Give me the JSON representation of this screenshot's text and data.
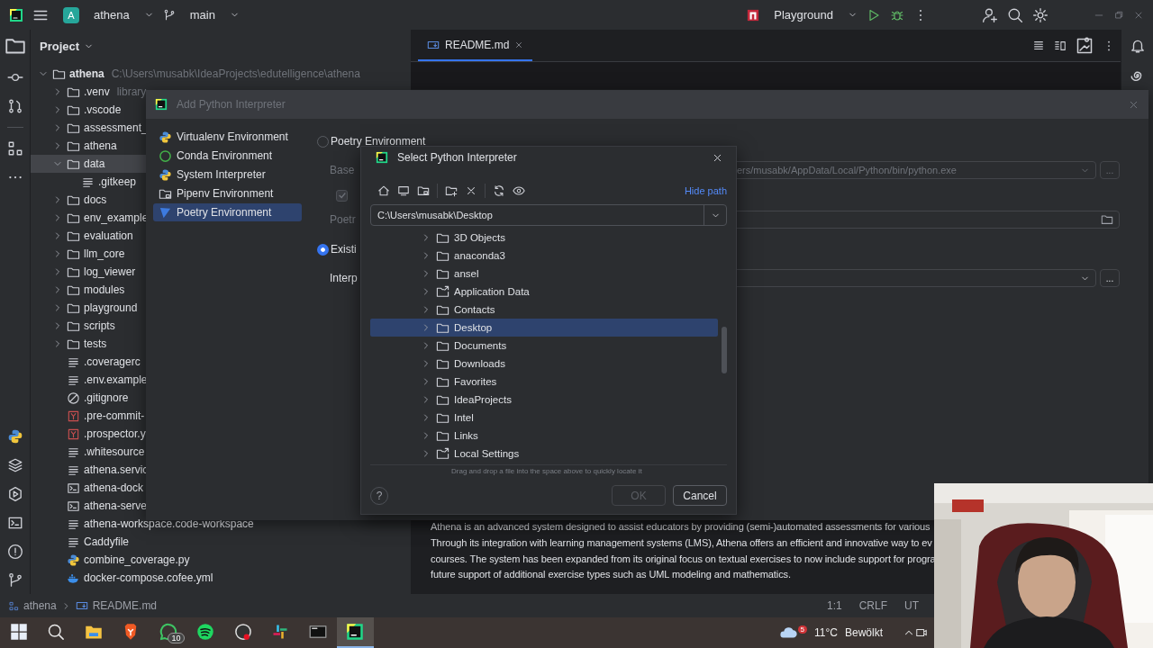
{
  "title_bar": {
    "project_badge": "A",
    "project": "athena",
    "branch": "main",
    "run_config": "Playground"
  },
  "project_panel": {
    "title": "Project",
    "tree": [
      {
        "name": "athena",
        "path": "C:\\Users\\musabk\\IdeaProjects\\edutelligence\\athena",
        "kind": "folder",
        "expanded": true,
        "selected": false,
        "children": [
          {
            "name": ".venv",
            "hint": "library",
            "kind": "folder",
            "expanded": false,
            "selected": false
          },
          {
            "name": ".vscode",
            "kind": "folder",
            "expanded": false,
            "selected": false
          },
          {
            "name": "assessment_",
            "kind": "folder",
            "expanded": false,
            "selected": false
          },
          {
            "name": "athena",
            "kind": "folder",
            "expanded": false,
            "selected": false
          },
          {
            "name": "data",
            "kind": "folder",
            "expanded": true,
            "selected": true,
            "children": [
              {
                "name": ".gitkeep",
                "kind": "text",
                "selected": false
              }
            ]
          },
          {
            "name": "docs",
            "kind": "folder",
            "expanded": false,
            "selected": false
          },
          {
            "name": "env_example",
            "kind": "folder",
            "expanded": false,
            "selected": false
          },
          {
            "name": "evaluation",
            "kind": "folder",
            "expanded": false,
            "selected": false
          },
          {
            "name": "llm_core",
            "kind": "folder",
            "expanded": false,
            "selected": false
          },
          {
            "name": "log_viewer",
            "kind": "folder",
            "expanded": false,
            "selected": false
          },
          {
            "name": "modules",
            "kind": "folder",
            "expanded": false,
            "selected": false
          },
          {
            "name": "playground",
            "kind": "folder",
            "expanded": false,
            "selected": false
          },
          {
            "name": "scripts",
            "kind": "folder",
            "expanded": false,
            "selected": false
          },
          {
            "name": "tests",
            "kind": "folder",
            "expanded": false,
            "selected": false
          },
          {
            "name": ".coveragerc",
            "kind": "text",
            "selected": false
          },
          {
            "name": ".env.example",
            "kind": "text",
            "selected": false
          },
          {
            "name": ".gitignore",
            "kind": "ignore",
            "selected": false
          },
          {
            "name": ".pre-commit-",
            "kind": "yaml",
            "selected": false
          },
          {
            "name": ".prospector.y",
            "kind": "yaml",
            "selected": false
          },
          {
            "name": ".whitesource",
            "kind": "text",
            "selected": false
          },
          {
            "name": "athena.servic",
            "kind": "text",
            "selected": false
          },
          {
            "name": "athena-dock",
            "kind": "shell",
            "selected": false
          },
          {
            "name": "athena-serve",
            "kind": "shell",
            "selected": false
          },
          {
            "name": "athena-workspace.code-workspace",
            "kind": "text",
            "selected": false
          },
          {
            "name": "Caddyfile",
            "kind": "text",
            "selected": false
          },
          {
            "name": "combine_coverage.py",
            "kind": "python",
            "selected": false
          },
          {
            "name": "docker-compose.cofee.yml",
            "kind": "docker",
            "selected": false
          }
        ]
      }
    ]
  },
  "editor": {
    "tabs": [
      {
        "label": "README.md",
        "selected": true
      }
    ],
    "paragraph": [
      "Athena is an advanced system designed to assist educators by providing (semi-)automated assessments for various",
      "Through its integration with learning management systems (LMS), Athena offers an efficient and innovative way to ev",
      "courses. The system has been expanded from its original focus on textual exercises to now include support for progra",
      "future support of additional exercise types such as UML modeling and mathematics."
    ]
  },
  "add_dialog": {
    "title": "Add Python Interpreter",
    "environments": [
      {
        "label": "Virtualenv Environment",
        "kind": "virtualenv",
        "selected": false
      },
      {
        "label": "Conda Environment",
        "kind": "conda",
        "selected": false
      },
      {
        "label": "System Interpreter",
        "kind": "system",
        "selected": false
      },
      {
        "label": "Pipenv Environment",
        "kind": "pipenv",
        "selected": false
      },
      {
        "label": "Poetry Environment",
        "kind": "poetry",
        "selected": true
      }
    ],
    "options": [
      {
        "label": "Poetry Environment",
        "selected": false
      },
      {
        "label": "Existi",
        "selected": true
      }
    ],
    "base_label": "Base",
    "base_value": "ers/musabk/AppData/Local/Python/bin/python.exe",
    "checkbox": {
      "checked": true
    },
    "poetry_label": "Poetr",
    "interpreter_label": "Interp",
    "browse": "..."
  },
  "select_dialog": {
    "title": "Select Python Interpreter",
    "hide_path": "Hide path",
    "path": "C:\\Users\\musabk\\Desktop",
    "items": [
      {
        "name": "3D Objects",
        "kind": "folder",
        "selected": false
      },
      {
        "name": "anaconda3",
        "kind": "folder",
        "selected": false
      },
      {
        "name": "ansel",
        "kind": "folder",
        "selected": false
      },
      {
        "name": "Application Data",
        "kind": "link",
        "selected": false
      },
      {
        "name": "Contacts",
        "kind": "folder",
        "selected": false
      },
      {
        "name": "Desktop",
        "kind": "folder",
        "selected": true
      },
      {
        "name": "Documents",
        "kind": "folder",
        "selected": false
      },
      {
        "name": "Downloads",
        "kind": "folder",
        "selected": false
      },
      {
        "name": "Favorites",
        "kind": "folder",
        "selected": false
      },
      {
        "name": "IdeaProjects",
        "kind": "folder",
        "selected": false
      },
      {
        "name": "Intel",
        "kind": "folder",
        "selected": false
      },
      {
        "name": "Links",
        "kind": "folder",
        "selected": false
      },
      {
        "name": "Local Settings",
        "kind": "link",
        "selected": false
      }
    ],
    "hint": "Drag and drop a file into the space above to quickly locate it",
    "help": "?",
    "ok": {
      "label": "OK",
      "disabled": true
    },
    "cancel": "Cancel"
  },
  "status_bar": {
    "breadcrumbs": [
      "athena",
      "README.md"
    ],
    "right": [
      "1:1",
      "CRLF",
      "UT"
    ]
  },
  "taskbar": {
    "apps": [
      {
        "kind": "windows",
        "selected": false
      },
      {
        "kind": "search",
        "selected": false
      },
      {
        "kind": "explorer",
        "selected": false
      },
      {
        "kind": "brave",
        "selected": false
      },
      {
        "kind": "whatsapp",
        "badge": "10",
        "selected": false
      },
      {
        "kind": "spotify",
        "selected": false
      },
      {
        "kind": "obs",
        "selected": false
      },
      {
        "kind": "slack",
        "selected": false
      },
      {
        "kind": "terminal",
        "selected": false
      },
      {
        "kind": "pycharm",
        "selected": true
      }
    ],
    "weather": {
      "badge": "5",
      "temperature": "11°C",
      "condition": "Bewölkt"
    }
  }
}
